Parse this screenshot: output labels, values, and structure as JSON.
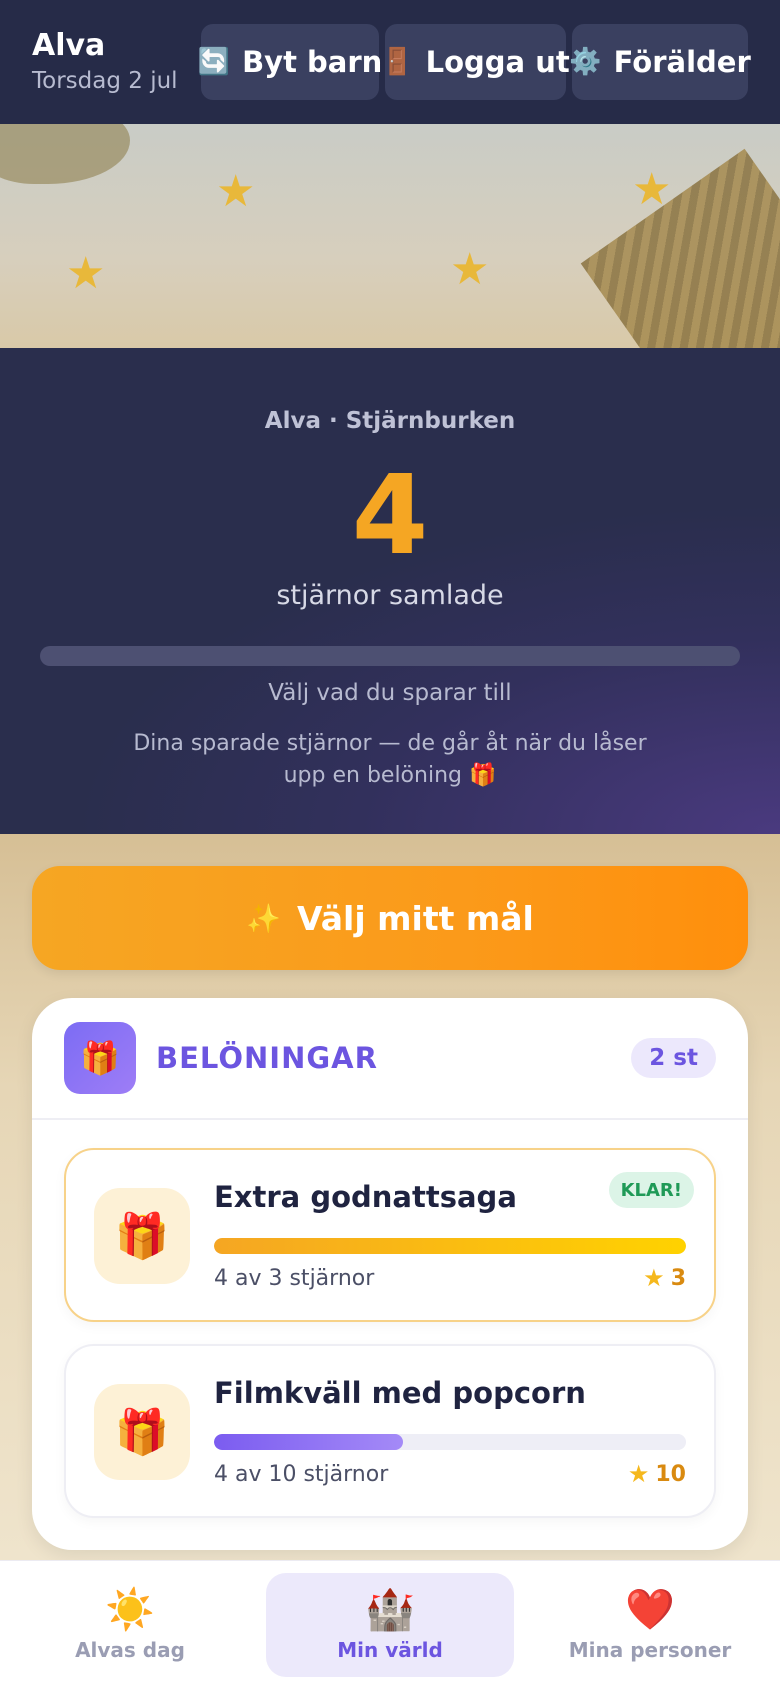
{
  "header": {
    "user_name": "Alva",
    "date": "Torsdag 2 jul",
    "buttons": [
      {
        "label": "Byt barn",
        "icon": "refresh-icon",
        "glyph": "🔄"
      },
      {
        "label": "Logga ut",
        "icon": "door-icon",
        "glyph": "🚪"
      },
      {
        "label": "Förälder",
        "icon": "gear-icon",
        "glyph": "⚙️"
      }
    ]
  },
  "jar": {
    "title": "Alva · Stjärnburken",
    "count": "4",
    "subtitle": "stjärnor samlade",
    "progress": 0,
    "hint": "Välj vad du sparar till",
    "description": "Dina sparade stjärnor — de går åt när du låser upp en belöning 🎁"
  },
  "goal_button": {
    "icon": "sparkles-icon",
    "glyph": "✨",
    "label": "Välj mitt mål"
  },
  "rewards": {
    "icon": "gift-icon",
    "glyph": "🎁",
    "title": "BELÖNINGAR",
    "count": "2 st",
    "items": [
      {
        "name": "Extra godnattsaga",
        "glyph": "🎁",
        "badge": "KLAR!",
        "progress_text": "4 av 3 stjärnor",
        "cost": "3",
        "progress": 1.0
      },
      {
        "name": "Filmkväll med popcorn",
        "glyph": "🎁",
        "badge": "",
        "progress_text": "4 av 10 stjärnor",
        "cost": "10",
        "progress": 0.4
      }
    ]
  },
  "nav": {
    "items": [
      {
        "label": "Alvas dag",
        "icon": "sun-icon",
        "glyph": "☀️",
        "active": false
      },
      {
        "label": "Min värld",
        "icon": "castle-icon",
        "glyph": "🏰",
        "active": true
      },
      {
        "label": "Mina personer",
        "icon": "heart-icon",
        "glyph": "❤️",
        "active": false
      }
    ]
  },
  "colors": {
    "header_bg": "#262b48",
    "accent_orange": "#f5a623",
    "accent_purple": "#6c55e0",
    "done_green": "#1f9a57"
  }
}
